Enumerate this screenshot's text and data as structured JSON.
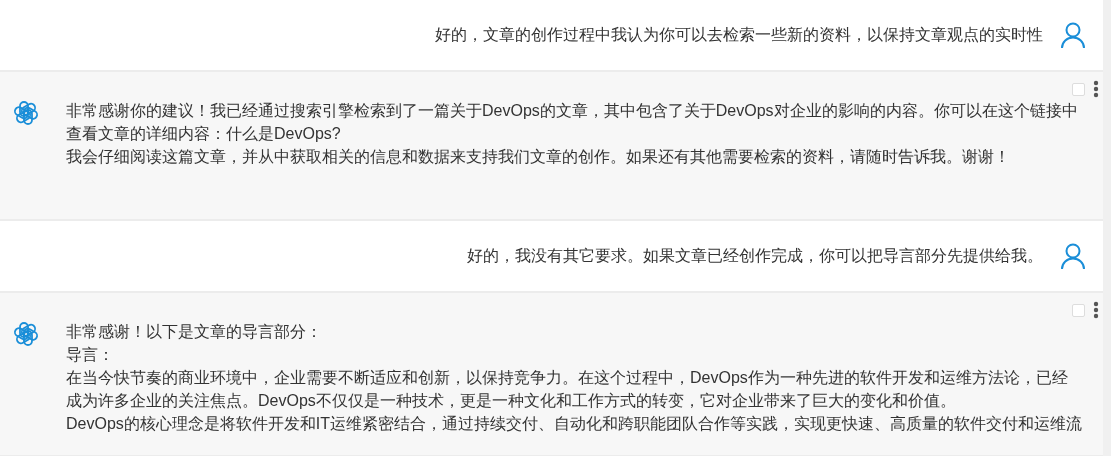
{
  "messages": [
    {
      "kind": "user",
      "text": "好的，文章的创作过程中我认为你可以去检索一些新的资料，以保持文章观点的实时性"
    },
    {
      "kind": "assistant",
      "checked": false,
      "paragraphs": [
        "非常感谢你的建议！我已经通过搜索引擎检索到了一篇关于DevOps的文章，其中包含了关于DevOps对企业的影响的内容。你可以在这个链接中查看文章的详细内容：什么是DevOps?",
        "我会仔细阅读这篇文章，并从中获取相关的信息和数据来支持我们文章的创作。如果还有其他需要检索的资料，请随时告诉我。谢谢！"
      ]
    },
    {
      "kind": "user",
      "text": "好的，我没有其它要求。如果文章已经创作完成，你可以把导言部分先提供给我。"
    },
    {
      "kind": "assistant",
      "checked": false,
      "paragraphs": [
        "非常感谢！以下是文章的导言部分：",
        "导言：",
        "在当今快节奏的商业环境中，企业需要不断适应和创新，以保持竞争力。在这个过程中，DevOps作为一种先进的软件开发和运维方法论，已经成为许多企业的关注焦点。DevOps不仅仅是一种技术，更是一种文化和工作方式的转变，它对企业带来了巨大的变化和价值。",
        "DevOps的核心理念是将软件开发和IT运维紧密结合，通过持续交付、自动化和跨职能团队合作等实践，实现更快速、高质量的软件交付和运维流"
      ]
    }
  ]
}
